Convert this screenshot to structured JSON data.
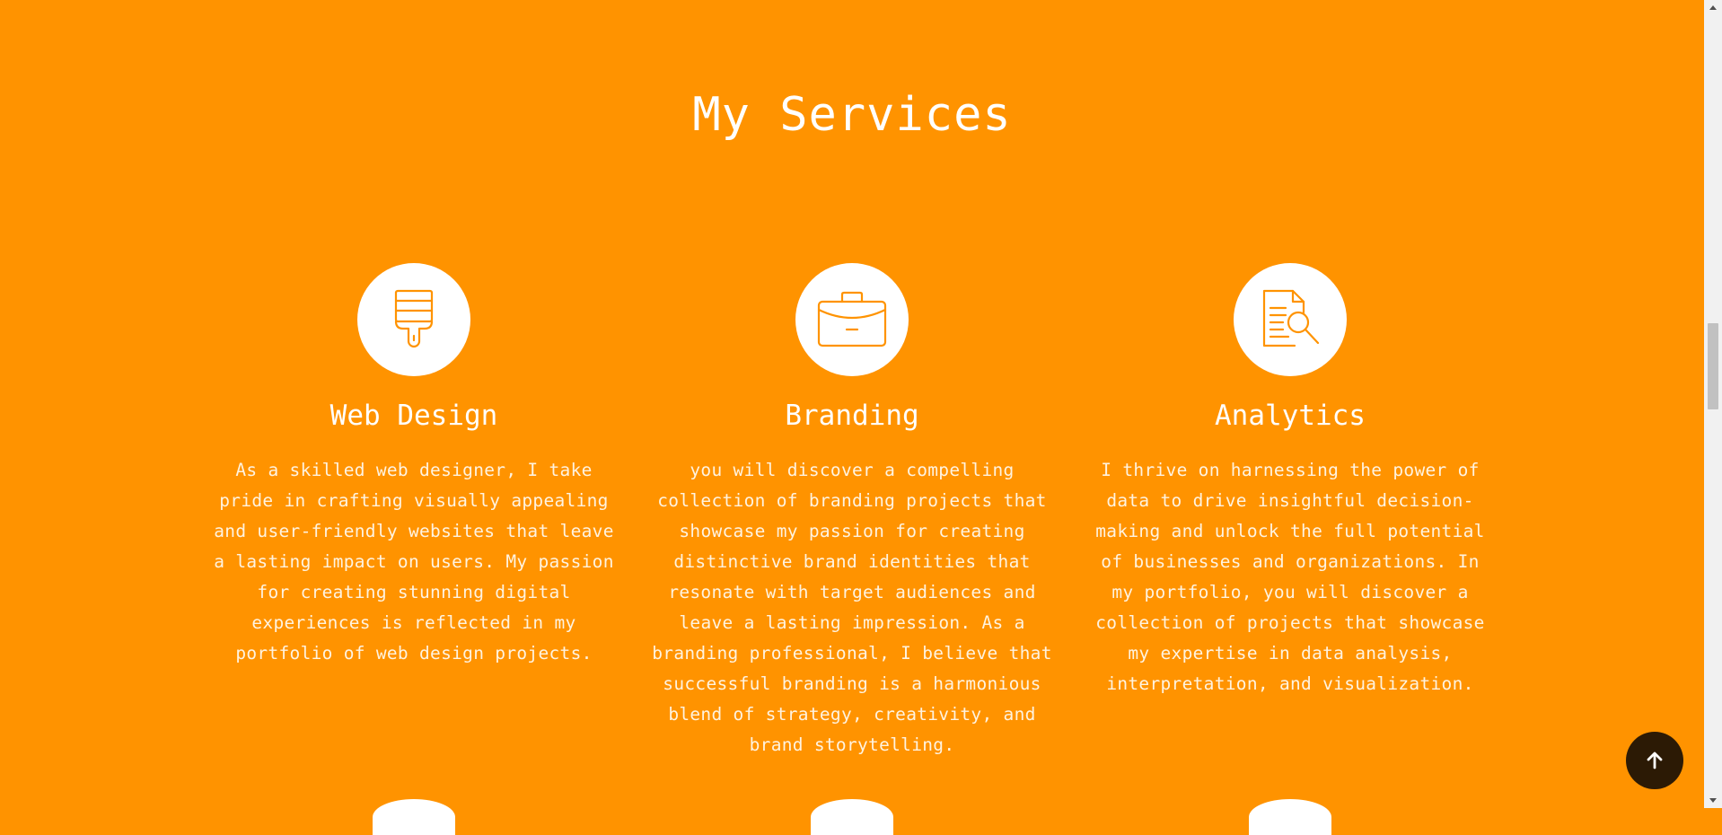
{
  "section": {
    "title": "My Services"
  },
  "services": [
    {
      "icon": "paintbrush-icon",
      "title": "Web Design",
      "description": "As a skilled web designer, I take pride in crafting visually appealing and user-friendly websites that leave a lasting impact on users. My passion for creating stunning digital experiences is reflected in my portfolio of web design projects."
    },
    {
      "icon": "briefcase-icon",
      "title": "Branding",
      "description": "you will discover a compelling collection of branding projects that showcase my passion for creating distinctive brand identities that resonate with target audiences and leave a lasting impression. As a branding professional, I believe that successful branding is a harmonious blend of strategy, creativity, and brand storytelling."
    },
    {
      "icon": "document-search-icon",
      "title": "Analytics",
      "description": "I thrive on harnessing the power of data to drive insightful decision-making and unlock the full potential of businesses and organizations. In my portfolio, you will discover a collection of projects that showcase my expertise in data analysis, interpretation, and visualization."
    }
  ],
  "back_to_top": {
    "icon": "arrow-up-icon"
  },
  "colors": {
    "background": "#ff9300",
    "text": "#ffffff",
    "icon_circle": "#ffffff",
    "icon_stroke": "#ff9300",
    "back_to_top_bg": "#2c1a05"
  }
}
